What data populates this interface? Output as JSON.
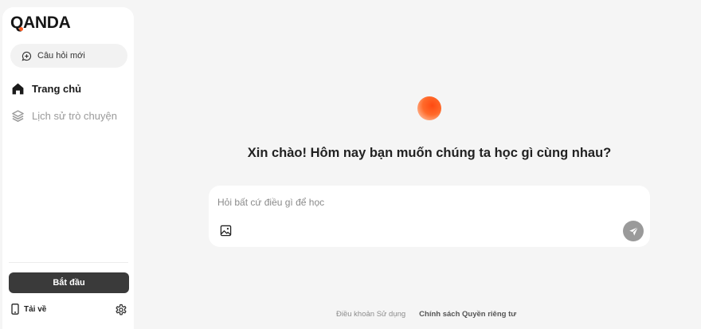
{
  "brand": {
    "logo_text": "QANDA",
    "accent_color": "#ff5a1f"
  },
  "sidebar": {
    "new_question_label": "Câu hỏi mới",
    "items": [
      {
        "label": "Trang chủ",
        "icon": "home-icon",
        "active": true
      },
      {
        "label": "Lịch sử trò chuyện",
        "icon": "layers-icon",
        "active": false
      }
    ],
    "start_label": "Bắt đầu",
    "download_label": "Tải về"
  },
  "main": {
    "greeting": "Xin chào! Hôm nay bạn muốn chúng ta học gì cùng nhau?",
    "input_placeholder": "Hỏi bất cứ điều gì để học"
  },
  "footer": {
    "terms_label": "Điều khoản Sử dụng",
    "privacy_label": "Chính sách Quyền riêng tư"
  }
}
